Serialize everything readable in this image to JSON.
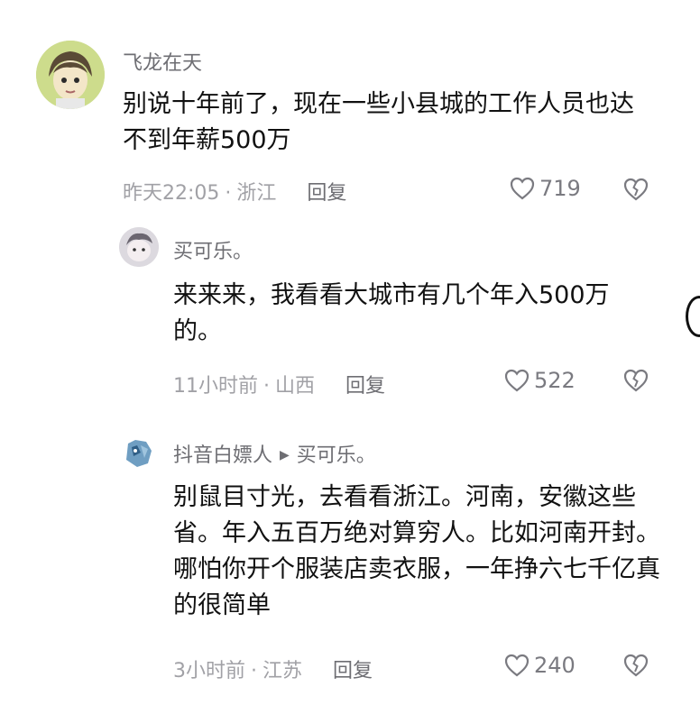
{
  "comments": [
    {
      "username": "飞龙在天",
      "text": "别说十年前了，现在一些小县城的工作人员也达不到年薪500万",
      "time": "昨天22:05",
      "location": "浙江",
      "reply_label": "回复",
      "likes": "719"
    },
    {
      "username": "买可乐。",
      "text": "来来来，我看看大城市有几个年入500万的。",
      "time": "11小时前",
      "location": "山西",
      "reply_label": "回复",
      "likes": "522"
    },
    {
      "username": "抖音白嫖人",
      "reply_to": "买可乐。",
      "text": "别鼠目寸光，去看看浙江。河南，安徽这些省。年入五百万绝对算穷人。比如河南开封。哪怕你开个服装店卖衣服，一年挣六七千亿真的很简单",
      "time": "3小时前",
      "location": "江苏",
      "reply_label": "回复",
      "likes": "240"
    }
  ],
  "icons": {
    "like": "heart-outline-icon",
    "dislike": "broken-heart-icon",
    "reply_arrow": "triangle-right-icon"
  },
  "colors": {
    "username": "#6e6e73",
    "meta": "#a1a1a6",
    "text": "#111111"
  }
}
